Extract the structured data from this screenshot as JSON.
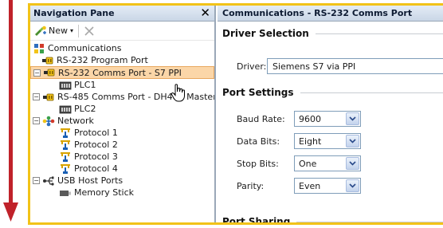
{
  "nav": {
    "title": "Navigation Pane",
    "new_label": "New",
    "items": [
      {
        "label": "Communications",
        "indent": 0,
        "expander": "",
        "icon": "comms-icon"
      },
      {
        "label": "RS-232 Program Port",
        "indent": 1,
        "expander": "",
        "icon": "serial-port-icon"
      },
      {
        "label": "RS-232 Comms Port - S7 PPI",
        "indent": 0,
        "expander": "−",
        "icon": "serial-port-icon",
        "selected": true
      },
      {
        "label": "PLC1",
        "indent": 2,
        "expander": "",
        "icon": "plc-icon"
      },
      {
        "label": "RS-485 Comms Port - DH485 Master",
        "indent": 0,
        "expander": "−",
        "icon": "serial-port-icon"
      },
      {
        "label": "PLC2",
        "indent": 2,
        "expander": "",
        "icon": "plc-icon"
      },
      {
        "label": "Network",
        "indent": 0,
        "expander": "−",
        "icon": "network-icon"
      },
      {
        "label": "Protocol 1",
        "indent": 2,
        "expander": "",
        "icon": "protocol-icon"
      },
      {
        "label": "Protocol 2",
        "indent": 2,
        "expander": "",
        "icon": "protocol-icon"
      },
      {
        "label": "Protocol 3",
        "indent": 2,
        "expander": "",
        "icon": "protocol-icon"
      },
      {
        "label": "Protocol 4",
        "indent": 2,
        "expander": "",
        "icon": "protocol-icon"
      },
      {
        "label": "USB Host Ports",
        "indent": 0,
        "expander": "−",
        "icon": "usb-icon"
      },
      {
        "label": "Memory Stick",
        "indent": 2,
        "expander": "",
        "icon": "memory-stick-icon"
      }
    ]
  },
  "panel": {
    "title": "Communications - RS-232 Comms Port",
    "driver_section": "Driver Selection",
    "driver_label": "Driver:",
    "driver_value": "Siemens S7 via PPI",
    "port_section": "Port Settings",
    "fields": [
      {
        "label": "Baud Rate:",
        "value": "9600"
      },
      {
        "label": "Data Bits:",
        "value": "Eight"
      },
      {
        "label": "Stop Bits:",
        "value": "One"
      },
      {
        "label": "Parity:",
        "value": "Even"
      }
    ],
    "next_section": "Port Sharing"
  },
  "colors": {
    "frame": "#f2c318",
    "arrow": "#c0222a",
    "selection": "#fbd6a8",
    "header": "#c9d6e6"
  }
}
